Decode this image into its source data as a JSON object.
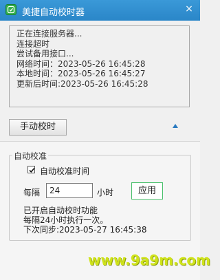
{
  "window": {
    "title": "美捷自动校时器",
    "close_glyph": "×"
  },
  "log": {
    "lines": [
      "正在连接服务器...",
      "连接超时",
      "尝试备用接口...",
      "网络时间：2023-05-26 16:45:28",
      "本地时间：2023-05-26 16:45:27",
      "更新后时间:2023-05-26 16:45:28"
    ]
  },
  "manual_button": "手动校时",
  "auto": {
    "group_title": "自动校准",
    "checkbox_label": "自动校准时间",
    "checked": true,
    "every_label": "每隔",
    "hours_value": "24",
    "hours_unit": "小时",
    "apply_button": "应用",
    "status_lines": [
      "已开启自动校时功能",
      "每隔24小时执行一次。",
      "下次同步:2023-05-27 16:45:38"
    ]
  },
  "watermark": "www.9a9m.com"
}
